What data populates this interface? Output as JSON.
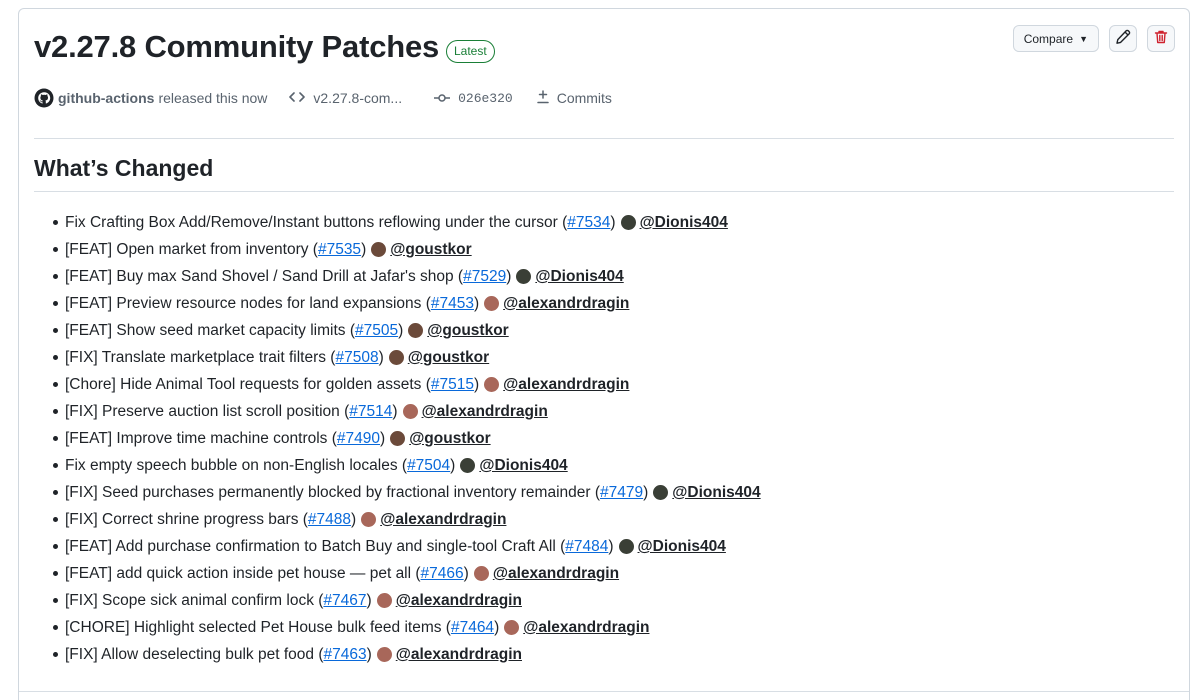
{
  "release": {
    "title": "v2.27.8 Community Patches",
    "badge": "Latest",
    "compare_label": "Compare",
    "author": "github-actions",
    "released_text": "released this now",
    "tag": "v2.27.8-com...",
    "commit_sha": "026e320",
    "commits_label": "Commits",
    "section_heading": "What’s Changed"
  },
  "colors": {
    "link": "#0969da",
    "badge_green": "#1a7f37",
    "danger": "#cf222e",
    "avatar_dionis": "#3a3f36",
    "avatar_goustkor": "#6b4a3a",
    "avatar_alexandrdragin": "#a8675a"
  },
  "changes": [
    {
      "text": "Fix Crafting Box Add/Remove/Instant buttons reflowing under the cursor (",
      "pr": "#7534",
      "user": "@Dionis404",
      "avatar": "dionis"
    },
    {
      "text": "[FEAT] Open market from inventory (",
      "pr": "#7535",
      "user": "@goustkor",
      "avatar": "goustkor"
    },
    {
      "text": "[FEAT] Buy max Sand Shovel / Sand Drill at Jafar's shop (",
      "pr": "#7529",
      "user": "@Dionis404",
      "avatar": "dionis"
    },
    {
      "text": "[FEAT] Preview resource nodes for land expansions (",
      "pr": "#7453",
      "user": "@alexandrdragin",
      "avatar": "alexandrdragin"
    },
    {
      "text": "[FEAT] Show seed market capacity limits (",
      "pr": "#7505",
      "user": "@goustkor",
      "avatar": "goustkor"
    },
    {
      "text": "[FIX] Translate marketplace trait filters (",
      "pr": "#7508",
      "user": "@goustkor",
      "avatar": "goustkor"
    },
    {
      "text": "[Chore] Hide Animal Tool requests for golden assets (",
      "pr": "#7515",
      "user": "@alexandrdragin",
      "avatar": "alexandrdragin"
    },
    {
      "text": "[FIX] Preserve auction list scroll position (",
      "pr": "#7514",
      "user": "@alexandrdragin",
      "avatar": "alexandrdragin"
    },
    {
      "text": "[FEAT] Improve time machine controls (",
      "pr": "#7490",
      "user": "@goustkor",
      "avatar": "goustkor"
    },
    {
      "text": "Fix empty speech bubble on non-English locales (",
      "pr": "#7504",
      "user": "@Dionis404",
      "avatar": "dionis"
    },
    {
      "text": "[FIX] Seed purchases permanently blocked by fractional inventory remainder (",
      "pr": "#7479",
      "user": "@Dionis404",
      "avatar": "dionis"
    },
    {
      "text": "[FIX] Correct shrine progress bars (",
      "pr": "#7488",
      "user": "@alexandrdragin",
      "avatar": "alexandrdragin"
    },
    {
      "text": "[FEAT] Add purchase confirmation to Batch Buy and single-tool Craft All (",
      "pr": "#7484",
      "user": "@Dionis404",
      "avatar": "dionis"
    },
    {
      "text": "[FEAT] add quick action inside pet house — pet all (",
      "pr": "#7466",
      "user": "@alexandrdragin",
      "avatar": "alexandrdragin"
    },
    {
      "text": "[FIX] Scope sick animal confirm lock (",
      "pr": "#7467",
      "user": "@alexandrdragin",
      "avatar": "alexandrdragin"
    },
    {
      "text": "[CHORE] Highlight selected Pet House bulk feed items (",
      "pr": "#7464",
      "user": "@alexandrdragin",
      "avatar": "alexandrdragin"
    },
    {
      "text": "[FIX] Allow deselecting bulk pet food (",
      "pr": "#7463",
      "user": "@alexandrdragin",
      "avatar": "alexandrdragin"
    }
  ]
}
